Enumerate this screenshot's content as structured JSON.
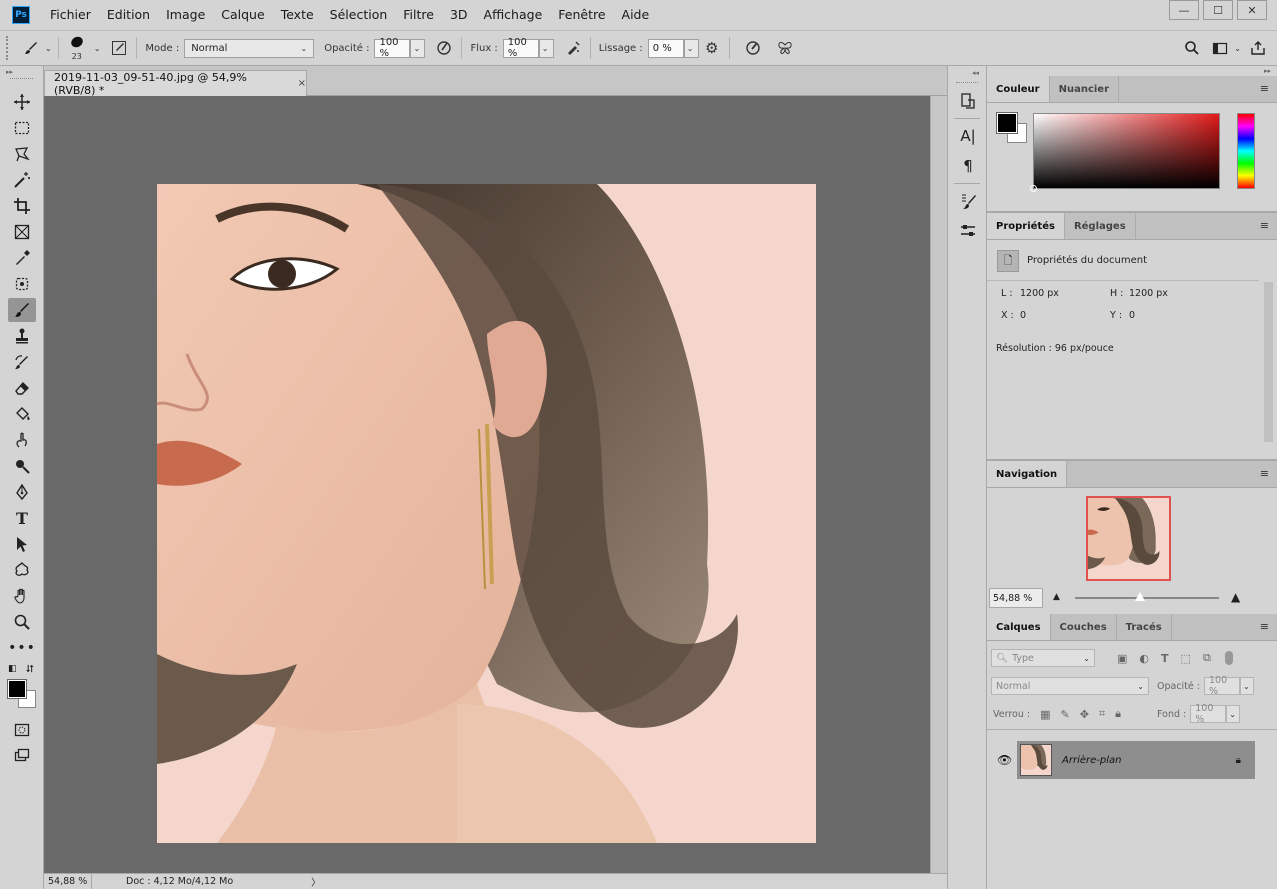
{
  "menu": {
    "app_logo": "Ps",
    "items": [
      "Fichier",
      "Edition",
      "Image",
      "Calque",
      "Texte",
      "Sélection",
      "Filtre",
      "3D",
      "Affichage",
      "Fenêtre",
      "Aide"
    ]
  },
  "window_controls": {
    "minimize": "—",
    "maximize": "☐",
    "close": "✕"
  },
  "options": {
    "brush_size": "23",
    "mode_label": "Mode :",
    "mode_value": "Normal",
    "opacity_label": "Opacité :",
    "opacity_value": "100 %",
    "flow_label": "Flux :",
    "flow_value": "100 %",
    "smoothing_label": "Lissage :",
    "smoothing_value": "0 %"
  },
  "document": {
    "tab_title": "2019-11-03_09-51-40.jpg @ 54,9% (RVB/8) *",
    "tab_close": "×",
    "status_zoom": "54,88 %",
    "status_doc": "Doc : 4,12 Mo/4,12 Mo",
    "status_arrow": "〉"
  },
  "color_panel": {
    "tabs": [
      "Couleur",
      "Nuancier"
    ],
    "foreground": "#000000",
    "background": "#ffffff"
  },
  "properties_panel": {
    "tabs": [
      "Propriétés",
      "Réglages"
    ],
    "heading": "Propriétés du document",
    "width_label": "L :",
    "width_value": "1200 px",
    "height_label": "H :",
    "height_value": "1200 px",
    "x_label": "X :",
    "x_value": "0",
    "y_label": "Y :",
    "y_value": "0",
    "resolution": "Résolution : 96 px/pouce"
  },
  "navigation_panel": {
    "tabs": [
      "Navigation"
    ],
    "zoom_value": "54,88 %",
    "zoom_slider_fraction": 0.45
  },
  "layers_panel": {
    "tabs": [
      "Calques",
      "Couches",
      "Tracés"
    ],
    "filter_placeholder": "Type",
    "blend_mode": "Normal",
    "opacity_label": "Opacité :",
    "opacity_value": "100 %",
    "lock_label": "Verrou :",
    "fill_label": "Fond :",
    "fill_value": "100 %",
    "layers": [
      {
        "name": "Arrière-plan",
        "visible": true,
        "locked": true
      }
    ]
  }
}
